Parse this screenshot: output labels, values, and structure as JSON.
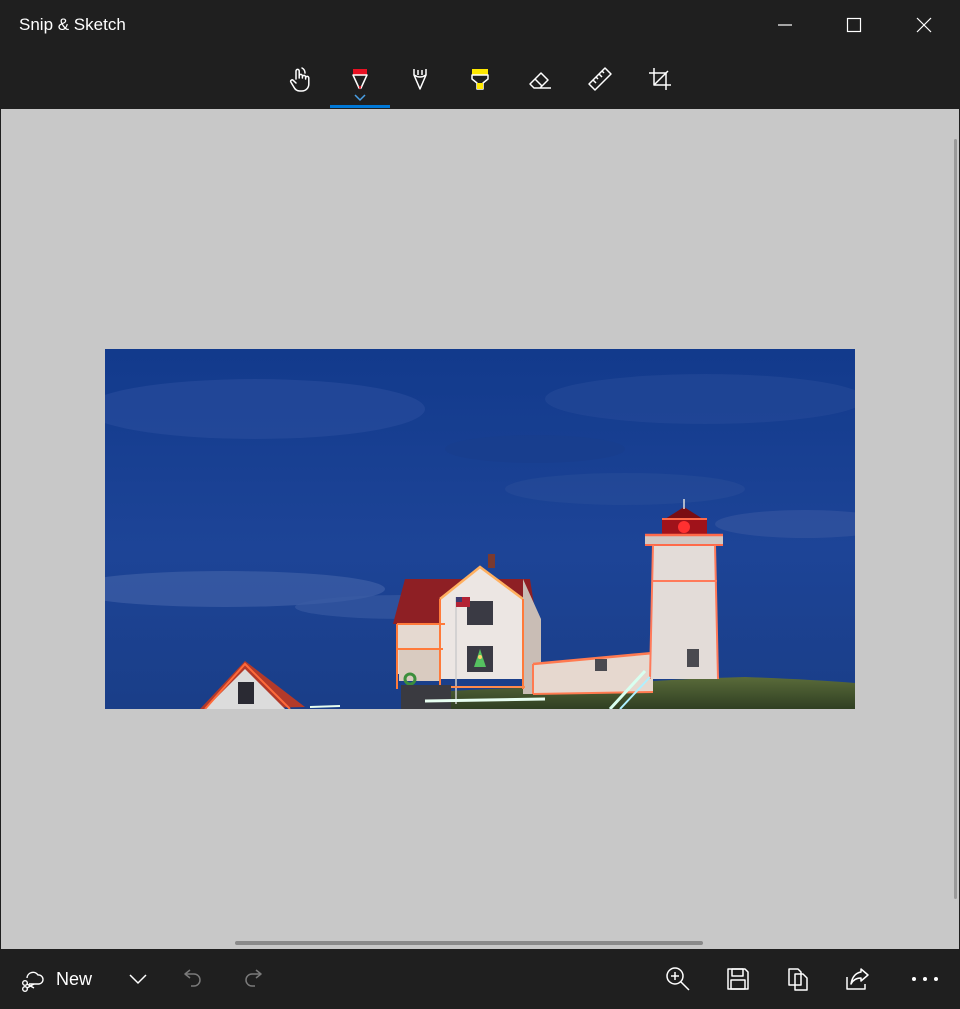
{
  "window": {
    "title": "Snip & Sketch",
    "controls": [
      "minimize-icon",
      "maximize-icon",
      "close-icon"
    ]
  },
  "toolbar": {
    "tools": [
      {
        "name": "touch-writing",
        "icon": "touch-hand-icon"
      },
      {
        "name": "ballpoint-pen",
        "icon": "ballpoint-pen-icon",
        "color": "#e81123",
        "selected": true
      },
      {
        "name": "pencil",
        "icon": "pencil-icon"
      },
      {
        "name": "highlighter",
        "icon": "highlighter-icon",
        "color": "#ffe800"
      },
      {
        "name": "eraser",
        "icon": "eraser-icon"
      },
      {
        "name": "ruler",
        "icon": "ruler-icon"
      },
      {
        "name": "crop",
        "icon": "crop-icon"
      }
    ],
    "accent_color": "#0078d7"
  },
  "bottom_bar": {
    "new_label": "New",
    "left_icons": [
      "new-snip-icon",
      "chevron-down-icon",
      "undo-icon",
      "redo-icon"
    ],
    "right_icons": [
      "zoom-icon",
      "save-icon",
      "copy-icon",
      "share-icon",
      "more-icon"
    ]
  },
  "colors": {
    "chrome": "#1f1f1f",
    "canvas": "#c8c8c8",
    "sky": "#1d3f8f"
  }
}
